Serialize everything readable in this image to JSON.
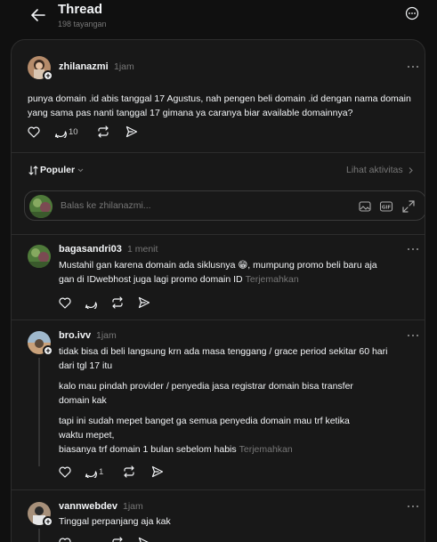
{
  "header": {
    "title": "Thread",
    "views": "198 tayangan"
  },
  "post": {
    "username": "zhilanazmi",
    "time": "1jam",
    "text": "punya domain .id abis tanggal 17 Agustus, nah pengen beli domain .id dengan nama domain yang sama pas nanti tanggal 17 gimana ya caranya biar available domainnya?",
    "reply_count": "10"
  },
  "sort": {
    "label": "Populer",
    "activity_label": "Lihat aktivitas"
  },
  "reply_box": {
    "placeholder": "Balas ke zhilanazmi..."
  },
  "translate_label": "Terjemahkan",
  "replies": [
    {
      "username": "bagasandri03",
      "time": "1 menit",
      "lines": [
        "Mustahil gan karena domain ada siklusnya 😁, mumpung promo beli baru aja",
        "gan di IDwebhost juga lagi promo domain ID"
      ]
    },
    {
      "username": "bro.ivv",
      "time": "1jam",
      "lines": [
        "tidak bisa di beli langsung krn ada masa tenggang / grace period sekitar 60 hari",
        "dari tgl 17 itu",
        "kalo mau pindah provider / penyedia jasa registrar domain bisa transfer",
        "domain kak",
        "tapi ini sudah mepet banget ga semua penyedia domain mau trf ketika",
        "waktu mepet,",
        "biasanya trf domain 1 bulan sebelom habis"
      ],
      "reply_count": "1"
    },
    {
      "username": "vannwebdev",
      "time": "1jam",
      "lines": [
        "Tinggal perpanjang aja kak"
      ]
    }
  ]
}
